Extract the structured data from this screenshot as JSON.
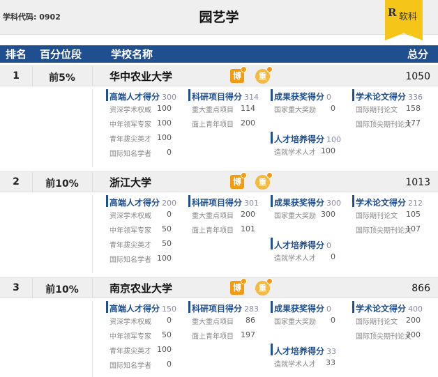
{
  "header_bar": {
    "subject_code": "学科代码: 0902",
    "title": "园艺学",
    "brand_logo": "R",
    "brand_text": "软科"
  },
  "columns": {
    "rank": "排名",
    "percentile": "百分位段",
    "school": "学校名称",
    "total": "总分"
  },
  "badges": {
    "bo": "博",
    "zhong": "重"
  },
  "schools": [
    {
      "rank": "1",
      "percentile": "前5%",
      "name": "华中农业大学",
      "total": "1050",
      "talent": {
        "label": "高端人才得分",
        "score": "300",
        "items": [
          {
            "label": "资深学术权威",
            "value": "100"
          },
          {
            "label": "中年领军专家",
            "value": "100"
          },
          {
            "label": "青年拔尖英才",
            "value": "100"
          },
          {
            "label": "国际知名学者",
            "value": "0"
          }
        ]
      },
      "research": {
        "label": "科研项目得分",
        "score": "314",
        "items": [
          {
            "label": "重大重点项目",
            "value": "114"
          },
          {
            "label": "面上青年项目",
            "value": "200"
          }
        ]
      },
      "award": {
        "label": "成果获奖得分",
        "score": "0",
        "items": [
          {
            "label": "国家重大奖励",
            "value": "0"
          }
        ]
      },
      "training": {
        "label": "人才培养得分",
        "score": "100",
        "items": [
          {
            "label": "造就学术人才",
            "value": "100"
          }
        ]
      },
      "paper": {
        "label": "学术论文得分",
        "score": "336",
        "items": [
          {
            "label": "国际期刊论文",
            "value": "158"
          },
          {
            "label": "国际顶尖期刊论文",
            "value": "177"
          }
        ]
      }
    },
    {
      "rank": "2",
      "percentile": "前10%",
      "name": "浙江大学",
      "total": "1013",
      "talent": {
        "label": "高端人才得分",
        "score": "200",
        "items": [
          {
            "label": "资深学术权威",
            "value": "0"
          },
          {
            "label": "中年领军专家",
            "value": "50"
          },
          {
            "label": "青年拔尖英才",
            "value": "50"
          },
          {
            "label": "国际知名学者",
            "value": "100"
          }
        ]
      },
      "research": {
        "label": "科研项目得分",
        "score": "301",
        "items": [
          {
            "label": "重大重点项目",
            "value": "200"
          },
          {
            "label": "面上青年项目",
            "value": "101"
          }
        ]
      },
      "award": {
        "label": "成果获奖得分",
        "score": "300",
        "items": [
          {
            "label": "国家重大奖励",
            "value": "300"
          }
        ]
      },
      "training": {
        "label": "人才培养得分",
        "score": "0",
        "items": [
          {
            "label": "造就学术人才",
            "value": "0"
          }
        ]
      },
      "paper": {
        "label": "学术论文得分",
        "score": "212",
        "items": [
          {
            "label": "国际期刊论文",
            "value": "105"
          },
          {
            "label": "国际顶尖期刊论文",
            "value": "107"
          }
        ]
      }
    },
    {
      "rank": "3",
      "percentile": "前10%",
      "name": "南京农业大学",
      "total": "866",
      "talent": {
        "label": "高端人才得分",
        "score": "150",
        "items": [
          {
            "label": "资深学术权威",
            "value": "0"
          },
          {
            "label": "中年领军专家",
            "value": "50"
          },
          {
            "label": "青年拔尖英才",
            "value": "100"
          },
          {
            "label": "国际知名学者",
            "value": "0"
          }
        ]
      },
      "research": {
        "label": "科研项目得分",
        "score": "283",
        "items": [
          {
            "label": "重大重点项目",
            "value": "86"
          },
          {
            "label": "面上青年项目",
            "value": "197"
          }
        ]
      },
      "award": {
        "label": "成果获奖得分",
        "score": "0",
        "items": [
          {
            "label": "国家重大奖励",
            "value": "0"
          }
        ]
      },
      "training": {
        "label": "人才培养得分",
        "score": "33",
        "items": [
          {
            "label": "造就学术人才",
            "value": "33"
          }
        ]
      },
      "paper": {
        "label": "学术论文得分",
        "score": "400",
        "items": [
          {
            "label": "国际期刊论文",
            "value": "200"
          },
          {
            "label": "国际顶尖期刊论文",
            "value": "200"
          }
        ]
      }
    }
  ]
}
